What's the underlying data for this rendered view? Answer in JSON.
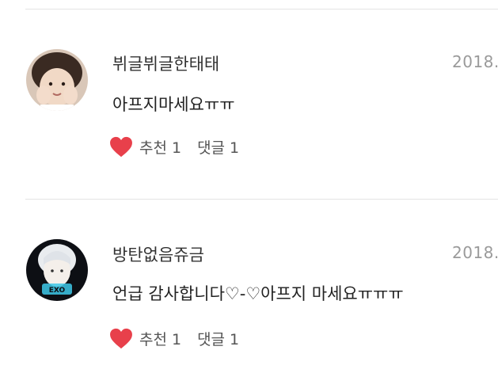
{
  "comments": [
    {
      "author": "뷔글뷔글한태태",
      "date": "2018.",
      "text": "아프지마세요ㅠㅠ",
      "like_label": "추천",
      "like_count": "1",
      "reply_label": "댓글",
      "reply_count": "1",
      "avatar_colors": {
        "bg": "#d9c7b8",
        "hair": "#3a2a22",
        "skin": "#f1d9c6"
      }
    },
    {
      "author": "방탄없음쥬금",
      "date": "2018.",
      "text": "언급 감사합니다♡-♡아프지 마세요ㅠㅠㅠ",
      "like_label": "추천",
      "like_count": "1",
      "reply_label": "댓글",
      "reply_count": "1",
      "avatar_colors": {
        "bg": "#0d0f14",
        "hair": "#e9ecef",
        "accent": "#3ec8e8"
      }
    }
  ],
  "colors": {
    "heart": "#e8404b",
    "divider": "#e4e4e4",
    "muted": "#9a9a9a"
  }
}
